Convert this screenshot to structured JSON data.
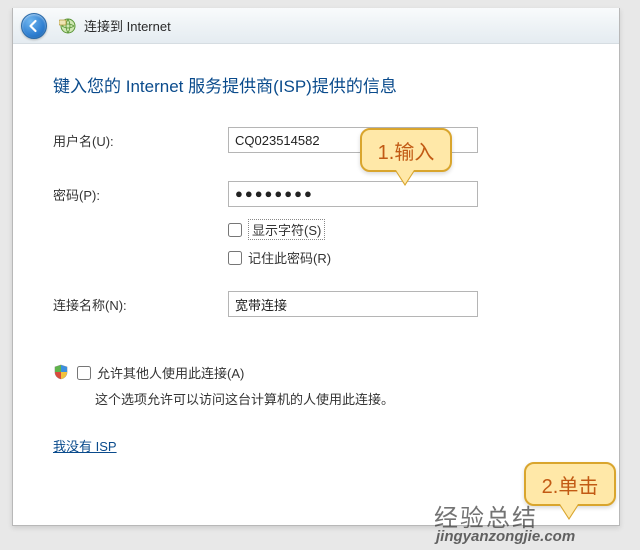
{
  "titlebar": {
    "title": "连接到 Internet"
  },
  "heading": "键入您的 Internet 服务提供商(ISP)提供的信息",
  "fields": {
    "username_label": "用户名(U):",
    "username_value": "CQ023514582",
    "password_label": "密码(P):",
    "password_display": "●●●●●●●●",
    "show_chars_label": "显示字符(S)",
    "remember_label": "记住此密码(R)",
    "conn_name_label": "连接名称(N):",
    "conn_name_value": "宽带连接"
  },
  "allow_others": {
    "label": "允许其他人使用此连接(A)",
    "desc": "这个选项允许可以访问这台计算机的人使用此连接。"
  },
  "noisp_link": "我没有 ISP",
  "callouts": {
    "c1": "1.输入",
    "c2": "2.单击"
  },
  "watermark": {
    "cn": "经验总结",
    "url": "jingyanzongjie.com"
  }
}
